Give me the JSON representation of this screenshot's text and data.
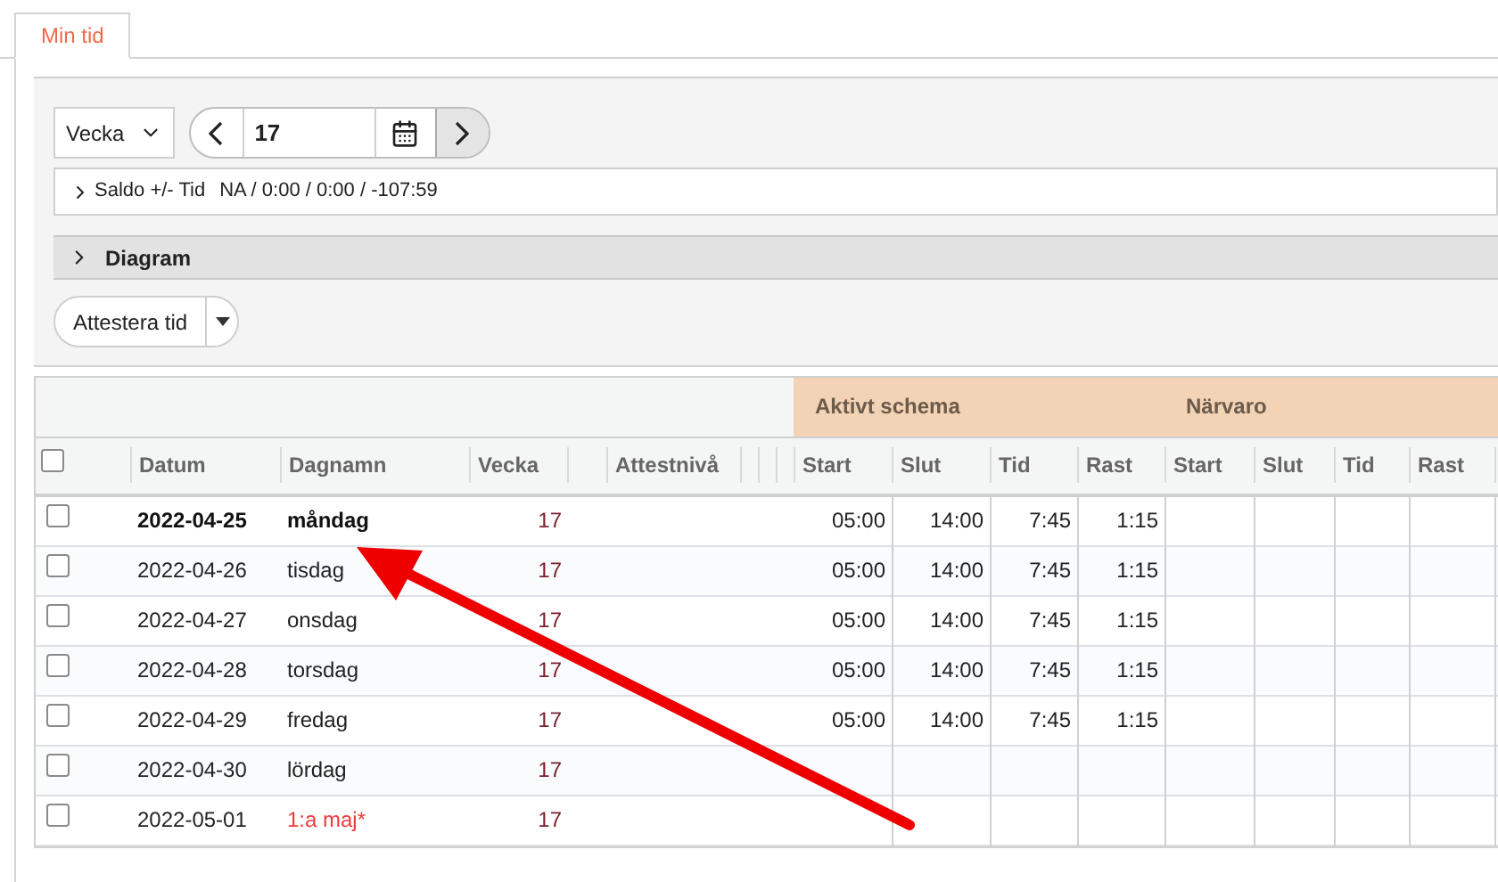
{
  "tabs": [
    {
      "label": "Min tid",
      "selected": true
    }
  ],
  "toolbar": {
    "period": "Vecka",
    "week": "17"
  },
  "saldo": {
    "label": "Saldo +/- Tid",
    "value": "NA / 0:00 / 0:00 / -107:59",
    "expanded": false
  },
  "diagram": {
    "label": "Diagram",
    "expanded": false
  },
  "attest_button": "Attestera tid",
  "table": {
    "groups": [
      {
        "label": "Aktivt schema"
      },
      {
        "label": "Närvaro"
      }
    ],
    "select_all": {
      "checked": false
    },
    "columns": [
      "Datum",
      "Dagnamn",
      "Vecka",
      "Attestnivå",
      "Start",
      "Slut",
      "Tid",
      "Rast",
      "Start",
      "Slut",
      "Tid",
      "Rast"
    ],
    "rows": [
      {
        "checked": false,
        "today": true,
        "holiday": false,
        "date": "2022-04-25",
        "day": "måndag",
        "week": "17",
        "start": "05:00",
        "end": "14:00",
        "time": "7:45",
        "break": "1:15"
      },
      {
        "checked": false,
        "today": false,
        "holiday": false,
        "date": "2022-04-26",
        "day": "tisdag",
        "week": "17",
        "start": "05:00",
        "end": "14:00",
        "time": "7:45",
        "break": "1:15"
      },
      {
        "checked": false,
        "today": false,
        "holiday": false,
        "date": "2022-04-27",
        "day": "onsdag",
        "week": "17",
        "start": "05:00",
        "end": "14:00",
        "time": "7:45",
        "break": "1:15"
      },
      {
        "checked": false,
        "today": false,
        "holiday": false,
        "date": "2022-04-28",
        "day": "torsdag",
        "week": "17",
        "start": "05:00",
        "end": "14:00",
        "time": "7:45",
        "break": "1:15"
      },
      {
        "checked": false,
        "today": false,
        "holiday": false,
        "date": "2022-04-29",
        "day": "fredag",
        "week": "17",
        "start": "05:00",
        "end": "14:00",
        "time": "7:45",
        "break": "1:15"
      },
      {
        "checked": false,
        "today": false,
        "holiday": false,
        "date": "2022-04-30",
        "day": "lördag",
        "week": "17"
      },
      {
        "checked": false,
        "today": false,
        "holiday": true,
        "date": "2022-05-01",
        "day": "1:a maj*",
        "week": "17"
      }
    ]
  }
}
